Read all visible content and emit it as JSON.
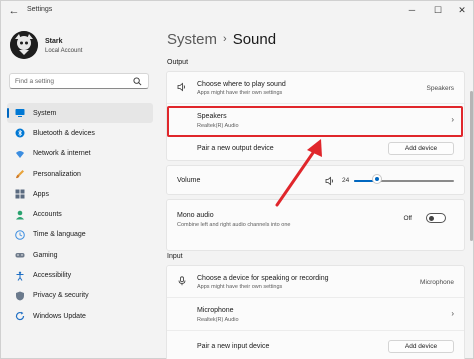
{
  "window": {
    "app_title": "Settings",
    "back_glyph": "←",
    "minimize_glyph": "─",
    "maximize_glyph": "☐",
    "close_glyph": "✕"
  },
  "user": {
    "name": "Stark",
    "account": "Local Account"
  },
  "search": {
    "placeholder": "Find a setting"
  },
  "sidebar": {
    "items": [
      {
        "label": "System",
        "icon": "monitor-icon",
        "active": true
      },
      {
        "label": "Bluetooth & devices",
        "icon": "bluetooth-icon"
      },
      {
        "label": "Network & internet",
        "icon": "wifi-icon"
      },
      {
        "label": "Personalization",
        "icon": "brush-icon"
      },
      {
        "label": "Apps",
        "icon": "apps-icon"
      },
      {
        "label": "Accounts",
        "icon": "person-icon"
      },
      {
        "label": "Time & language",
        "icon": "globe-clock-icon"
      },
      {
        "label": "Gaming",
        "icon": "gamepad-icon"
      },
      {
        "label": "Accessibility",
        "icon": "accessibility-icon"
      },
      {
        "label": "Privacy & security",
        "icon": "shield-icon"
      },
      {
        "label": "Windows Update",
        "icon": "update-icon"
      }
    ]
  },
  "header": {
    "parent": "System",
    "separator": "›",
    "current": "Sound"
  },
  "output": {
    "section_label": "Output",
    "choose_title": "Choose where to play sound",
    "choose_sub": "Apps might have their own settings",
    "choose_value": "Speakers",
    "speakers_title": "Speakers",
    "speakers_sub": "Realtek(R) Audio",
    "chevron": "›",
    "pair_label": "Pair a new output device",
    "pair_button": "Add device",
    "volume_label": "Volume",
    "volume_value": "24",
    "volume_level": 0.24,
    "mono_title": "Mono audio",
    "mono_sub": "Combine left and right audio channels into one",
    "mono_state": "Off"
  },
  "input": {
    "section_label": "Input",
    "choose_title": "Choose a device for speaking or recording",
    "choose_sub": "Apps might have their own settings",
    "choose_value": "Microphone",
    "mic_title": "Microphone",
    "mic_sub": "Realtek(R) Audio",
    "chevron": "›",
    "pair_label": "Pair a new input device",
    "pair_button": "Add device"
  },
  "colors": {
    "accent": "#0067c0",
    "highlight": "#e0262b"
  }
}
